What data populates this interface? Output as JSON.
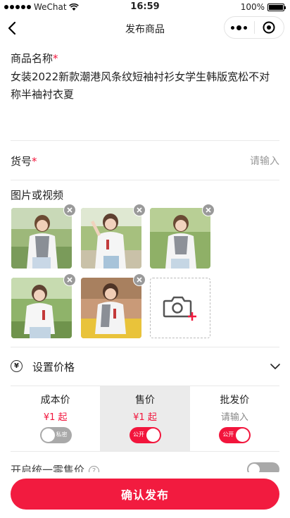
{
  "status_bar": {
    "carrier": "WeChat",
    "time": "16:59",
    "battery": "100%"
  },
  "nav": {
    "title": "发布商品"
  },
  "form": {
    "name_label": "商品名称",
    "name_required": "*",
    "name_value": "女装2022新款潮港风条纹短袖衬衫女学生韩版宽松不对称半袖衬衣夏",
    "sku_label": "货号",
    "sku_required": "*",
    "sku_placeholder": "请输入",
    "media_label": "图片或视频"
  },
  "price": {
    "section_title": "设置价格",
    "columns": [
      {
        "label": "成本价",
        "value": "¥1 起",
        "toggle_label": "私密",
        "toggle_on": false
      },
      {
        "label": "售价",
        "value": "¥1 起",
        "toggle_label": "公开",
        "toggle_on": true
      },
      {
        "label": "批发价",
        "value": "请输入",
        "toggle_label": "公开",
        "toggle_on": true
      }
    ]
  },
  "partial_row": {
    "label": "开启统一零售价",
    "help": "?"
  },
  "footer": {
    "confirm_label": "确认发布"
  },
  "colors": {
    "accent": "#f21b3f",
    "toggle_off": "#a9a9a9"
  }
}
